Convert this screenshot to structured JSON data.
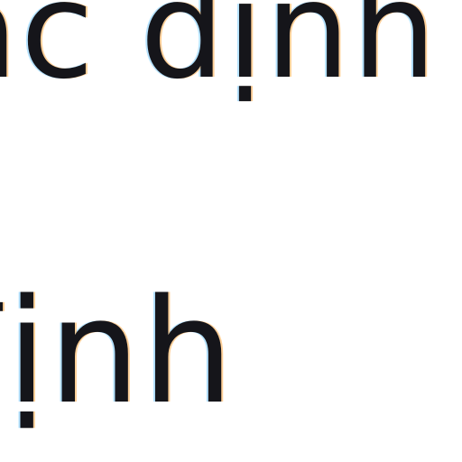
{
  "magnified_text": {
    "line_1": "ác  định",
    "line_2": "định"
  }
}
